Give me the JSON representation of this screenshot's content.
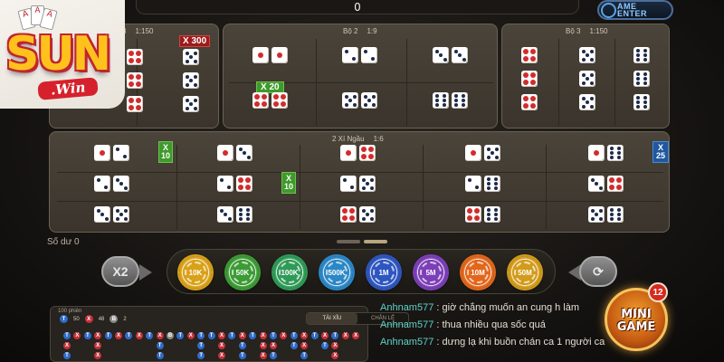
{
  "top_bar": {
    "balance": "0"
  },
  "game_center": {
    "label_line1": "AME",
    "label_line2": "ENTER"
  },
  "logo": {
    "brand": "SUN",
    "tagline": ".Win"
  },
  "panels": {
    "bo1": {
      "label": "3",
      "ratio": "1:150",
      "multiplier": "X 300"
    },
    "bo2": {
      "label": "Bộ 2",
      "ratio": "1:9",
      "multiplier": "X 20"
    },
    "bo3": {
      "label": "Bộ 3",
      "ratio": "1:150"
    },
    "xi_ngau": {
      "label": "2 Xí Ngầu",
      "ratio": "1:6",
      "multipliers": [
        "X 10",
        "X 10",
        "X 25"
      ]
    }
  },
  "chips_area": {
    "balance_label": "Số dư 0",
    "x2_label": "X2",
    "reload_label": "⟳",
    "chips": [
      {
        "label": "10K",
        "color": "#d9a11a"
      },
      {
        "label": "50K",
        "color": "#3c9b35"
      },
      {
        "label": "100K",
        "color": "#2f9a57"
      },
      {
        "label": "500K",
        "color": "#2b87c6"
      },
      {
        "label": "1M",
        "color": "#2e56c0"
      },
      {
        "label": "5M",
        "color": "#7c3fb7"
      },
      {
        "label": "10M",
        "color": "#e2661c"
      },
      {
        "label": "50M",
        "color": "#d29b1b"
      }
    ]
  },
  "history": {
    "title": "100 phiên",
    "legend": [
      {
        "symbol": "T",
        "count": "50",
        "color": "#2f6bcc"
      },
      {
        "symbol": "X",
        "count": "48",
        "color": "#c5303a"
      },
      {
        "symbol": "B",
        "count": "2",
        "color": "#8a8a8a"
      }
    ],
    "tabs": [
      "TÀI XỈU",
      "CHẴN LẺ"
    ],
    "row1": [
      "T",
      "X",
      "T",
      "X",
      "T",
      "X",
      "T",
      "X",
      "T",
      "X",
      "B",
      "T",
      "X",
      "T",
      "T",
      "X",
      "T",
      "X",
      "T",
      "X",
      "T",
      "X",
      "T",
      "X",
      "T",
      "X",
      "T",
      "X",
      "X"
    ],
    "row2": [
      "X",
      "",
      "",
      "X",
      "",
      "",
      "",
      "",
      "",
      "T",
      "",
      "",
      "",
      "T",
      "",
      "X",
      "",
      "T",
      "",
      "X",
      "X",
      "",
      "T",
      "X",
      "",
      "T",
      "X",
      "",
      ""
    ],
    "row3": [
      "T",
      "",
      "",
      "X",
      "",
      "",
      "",
      "",
      "",
      "T",
      "",
      "",
      "",
      "T",
      "",
      "X",
      "",
      "T",
      "",
      "X",
      "T",
      "",
      "",
      "T",
      "",
      "",
      "X",
      "",
      ""
    ]
  },
  "chat": [
    {
      "user": "Anhnam577",
      "message": ": giờ chẳng muốn an cung h làm"
    },
    {
      "user": "Anhnam577",
      "message": ": thua nhiều qua sốc quá"
    },
    {
      "user": "Anhnam577",
      "message": ": dưng lạ khi buồn chán ca 1 người ca"
    }
  ],
  "mini_game": {
    "line1": "MINI",
    "line2": "GAME",
    "badge": "12"
  },
  "colors": {
    "die_pip": "#1e2a48",
    "die_red_pip": "#d22b2b",
    "panel_bg": "#433c33"
  }
}
